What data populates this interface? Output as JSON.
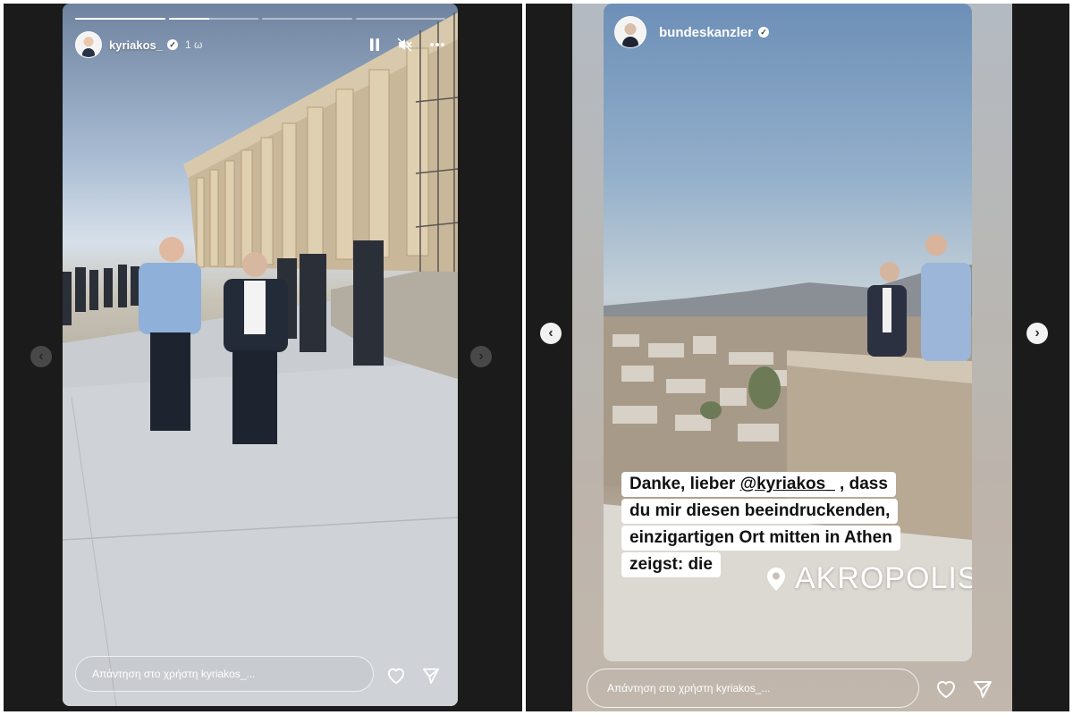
{
  "left_story": {
    "username": "kyriakos_",
    "time_ago": "1 ω",
    "progress": [
      1.0,
      0.45,
      0.0,
      0.0
    ],
    "reply_placeholder": "Απάντηση στο χρήστη kyriakos_...",
    "icons": {
      "pause": "pause-icon",
      "mute": "speaker-muted-icon",
      "more": "more-horizontal-icon",
      "like": "heart-icon",
      "share": "send-icon"
    }
  },
  "right_story": {
    "username": "bundeskanzler",
    "caption_lines": [
      {
        "before": "Danke, lieber ",
        "mention": "@kyriakos_",
        "after": " , dass"
      },
      {
        "before": "du mir diesen beeindruckenden,",
        "mention": "",
        "after": ""
      },
      {
        "before": "einzigartigen Ort mitten in Athen",
        "mention": "",
        "after": ""
      },
      {
        "before": "zeigst: die",
        "mention": "",
        "after": ""
      }
    ],
    "location_label": "AKROPOLIS",
    "reply_placeholder": "Απάντηση στο χρήστη kyriakos_..."
  },
  "navigation": {
    "prev": "chevron-left-icon",
    "next": "chevron-right-icon"
  }
}
